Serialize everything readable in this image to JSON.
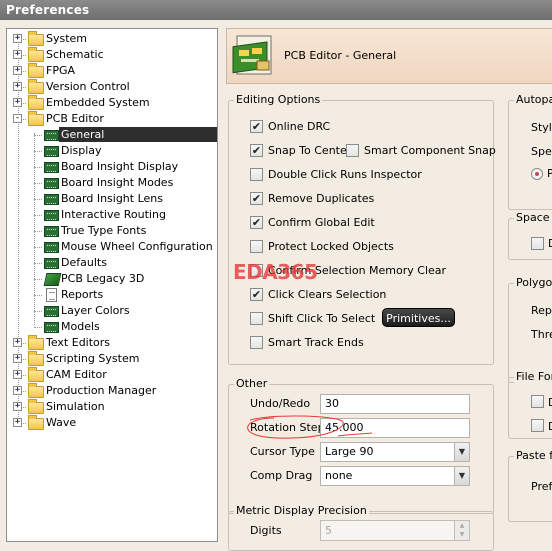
{
  "window": {
    "title": "Preferences"
  },
  "tree": {
    "items": [
      {
        "label": "System",
        "level": 0,
        "icon": "folder-icon",
        "expander": "+"
      },
      {
        "label": "Schematic",
        "level": 0,
        "icon": "folder-icon",
        "expander": "+"
      },
      {
        "label": "FPGA",
        "level": 0,
        "icon": "folder-icon",
        "expander": "+"
      },
      {
        "label": "Version Control",
        "level": 0,
        "icon": "folder-icon",
        "expander": "+"
      },
      {
        "label": "Embedded System",
        "level": 0,
        "icon": "folder-icon",
        "expander": "+"
      },
      {
        "label": "PCB Editor",
        "level": 0,
        "icon": "folder-open-icon",
        "expander": "-"
      },
      {
        "label": "General",
        "level": 1,
        "icon": "pcb-chip-icon",
        "selected": true
      },
      {
        "label": "Display",
        "level": 1,
        "icon": "pcb-chip-icon"
      },
      {
        "label": "Board Insight Display",
        "level": 1,
        "icon": "pcb-chip-icon"
      },
      {
        "label": "Board Insight Modes",
        "level": 1,
        "icon": "pcb-chip-icon"
      },
      {
        "label": "Board Insight Lens",
        "level": 1,
        "icon": "pcb-chip-icon"
      },
      {
        "label": "Interactive Routing",
        "level": 1,
        "icon": "pcb-chip-icon"
      },
      {
        "label": "True Type Fonts",
        "level": 1,
        "icon": "pcb-chip-icon"
      },
      {
        "label": "Mouse Wheel Configuration",
        "level": 1,
        "icon": "pcb-chip-icon"
      },
      {
        "label": "Defaults",
        "level": 1,
        "icon": "pcb-chip-icon"
      },
      {
        "label": "PCB Legacy 3D",
        "level": 1,
        "icon": "legacy-3d-icon"
      },
      {
        "label": "Reports",
        "level": 1,
        "icon": "report-document-icon"
      },
      {
        "label": "Layer Colors",
        "level": 1,
        "icon": "pcb-chip-icon"
      },
      {
        "label": "Models",
        "level": 1,
        "icon": "pcb-chip-icon"
      },
      {
        "label": "Text Editors",
        "level": 0,
        "icon": "folder-icon",
        "expander": "+"
      },
      {
        "label": "Scripting System",
        "level": 0,
        "icon": "folder-icon",
        "expander": "+"
      },
      {
        "label": "CAM Editor",
        "level": 0,
        "icon": "folder-icon",
        "expander": "+"
      },
      {
        "label": "Production Manager",
        "level": 0,
        "icon": "folder-icon",
        "expander": "+"
      },
      {
        "label": "Simulation",
        "level": 0,
        "icon": "folder-icon",
        "expander": "+"
      },
      {
        "label": "Wave",
        "level": 0,
        "icon": "folder-icon",
        "expander": "+"
      }
    ]
  },
  "header": {
    "title": "PCB Editor - General",
    "icon": "pcb-editor-icon"
  },
  "editing_options": {
    "title": "Editing Options",
    "checkboxes": [
      {
        "label": "Online DRC",
        "checked": true
      },
      {
        "label": "Snap To Center",
        "checked": true
      },
      {
        "label": "Smart Component Snap",
        "checked": false
      },
      {
        "label": "Double Click Runs Inspector",
        "checked": false
      },
      {
        "label": "Remove Duplicates",
        "checked": true
      },
      {
        "label": "Confirm Global Edit",
        "checked": true
      },
      {
        "label": "Protect Locked Objects",
        "checked": false
      },
      {
        "label": "Confirm Selection Memory Clear",
        "checked": false
      },
      {
        "label": "Click Clears Selection",
        "checked": true
      },
      {
        "label": "Shift Click To Select",
        "checked": false
      },
      {
        "label": "Smart Track Ends",
        "checked": false
      }
    ],
    "primitives_button": "Primitives..."
  },
  "other": {
    "title": "Other",
    "undo_redo_label": "Undo/Redo",
    "undo_redo_value": "30",
    "rotation_step_label": "Rotation Step",
    "rotation_step_value": "45.000",
    "cursor_type_label": "Cursor Type",
    "cursor_type_value": "Large 90",
    "comp_drag_label": "Comp Drag",
    "comp_drag_value": "none"
  },
  "metric": {
    "title": "Metric Display Precision",
    "digits_label": "Digits",
    "digits_value": "5"
  },
  "right_column": {
    "autopan_title": "Autopan",
    "style_label": "Style",
    "speed_label": "Speed",
    "radio_label": "P",
    "space_title": "Space N",
    "space_check": "D",
    "polygon_title": "Polygon",
    "repour_label": "Rep",
    "threshold_label": "Thre",
    "file_title": "File For",
    "file_check1": "D",
    "file_check2": "D",
    "paste_title": "Paste fr",
    "pref_label": "Prefe"
  },
  "watermark": "EDA365",
  "colors": {
    "titlebar": "#7a7a7a",
    "selection": "#2d2d2d",
    "panel_bg": "#f3ece2",
    "header_bg": "#f4dcc6",
    "annotation": "#e43a3a"
  }
}
